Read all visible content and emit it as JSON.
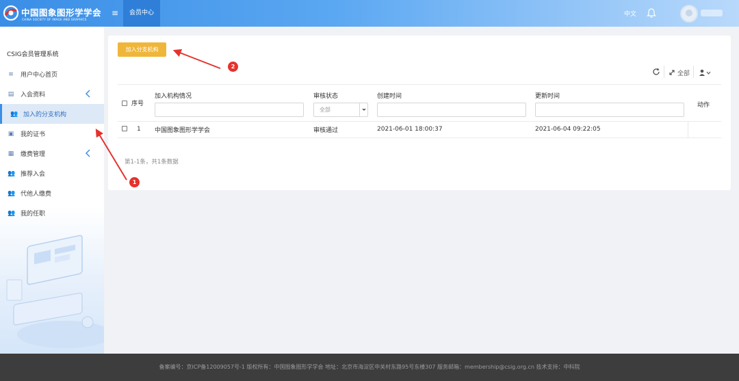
{
  "header": {
    "logo_title": "中国图象图形学学会",
    "logo_subtitle": "CHINA SOCIETY OF IMAGE AND GRAPHICS",
    "top_tab": "会员中心",
    "language": "中文",
    "menu_icon": "hamburger-icon",
    "bell_icon": "bell-icon"
  },
  "sidebar": {
    "system_title": "CSIG会员管理系统",
    "items": [
      {
        "label": "用户中心首页",
        "icon": "menu-icon"
      },
      {
        "label": "入会资料",
        "icon": "form-icon",
        "expandable": true
      },
      {
        "label": "加入的分支机构",
        "icon": "users-icon",
        "active": true
      },
      {
        "label": "我的证书",
        "icon": "certificate-icon"
      },
      {
        "label": "缴费管理",
        "icon": "payment-icon",
        "expandable": true
      },
      {
        "label": "推荐入会",
        "icon": "users-icon"
      },
      {
        "label": "代他人缴费",
        "icon": "users-icon"
      },
      {
        "label": "我的任职",
        "icon": "users-icon"
      }
    ]
  },
  "main": {
    "add_button": "加入分支机构",
    "toolbar": {
      "refresh_icon": "refresh-icon",
      "expand_label": "全部",
      "columns_icon": "user-columns-icon"
    },
    "table": {
      "headers": {
        "index": "序号",
        "org": "加入机构情况",
        "status": "审核状态",
        "created": "创建时间",
        "updated": "更新时间",
        "action": "动作"
      },
      "status_filter_value": "全部",
      "rows": [
        {
          "index": "1",
          "org": "中国图象图形学学会",
          "status": "审核通过",
          "created": "2021-06-01 18:00:37",
          "updated": "2021-06-04 09:22:05"
        }
      ]
    },
    "pagination": "第1-1条，共1条数据"
  },
  "annotations": {
    "badge_1": "1",
    "badge_2": "2",
    "color": "#e5322d"
  },
  "footer": {
    "text": "备案编号：京ICP备12009057号-1 版权所有：中国图象图形学学会 地址：北京市海淀区中关村东路95号东楼307 服务邮箱：membership@csig.org.cn 技术支持：中科院"
  },
  "colors": {
    "accent": "#3a8ee6",
    "button": "#f0b63a"
  }
}
